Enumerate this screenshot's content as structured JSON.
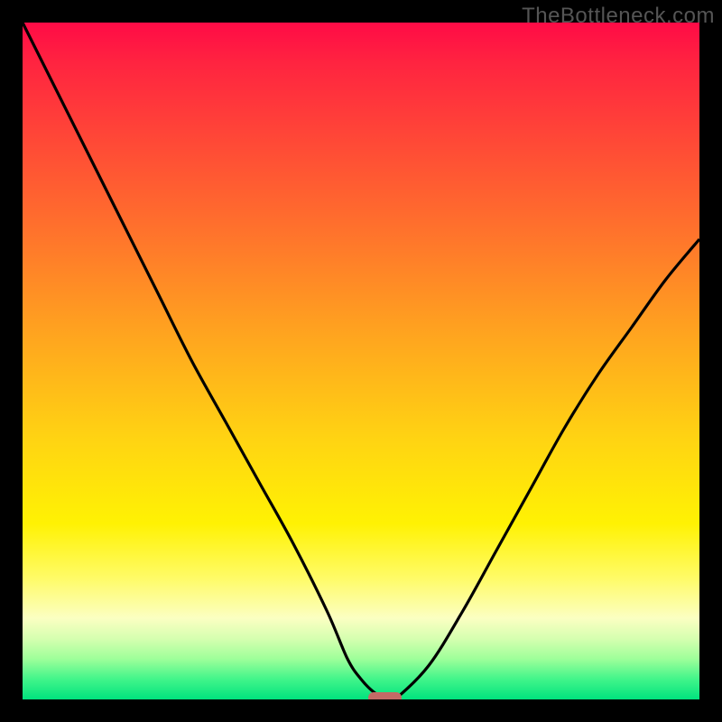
{
  "watermark": "TheBottleneck.com",
  "colors": {
    "curve_stroke": "#000000",
    "marker_fill": "#c46a66",
    "frame_bg": "#000000"
  },
  "chart_data": {
    "type": "line",
    "title": "",
    "xlabel": "",
    "ylabel": "",
    "xlim": [
      0,
      100
    ],
    "ylim": [
      0,
      100
    ],
    "grid": false,
    "legend": false,
    "series": [
      {
        "name": "bottleneck-curve",
        "x": [
          0,
          5,
          10,
          15,
          20,
          25,
          30,
          35,
          40,
          45,
          48,
          50,
          52,
          54,
          55,
          60,
          65,
          70,
          75,
          80,
          85,
          90,
          95,
          100
        ],
        "y": [
          100,
          90,
          80,
          70,
          60,
          50,
          41,
          32,
          23,
          13,
          6,
          3,
          1,
          0,
          0,
          5,
          13,
          22,
          31,
          40,
          48,
          55,
          62,
          68
        ]
      }
    ],
    "marker": {
      "x_start": 51,
      "x_end": 56,
      "y": 0
    },
    "gradient_stops": [
      {
        "pos": 0,
        "color": "#ff0b46"
      },
      {
        "pos": 18,
        "color": "#ff4a36"
      },
      {
        "pos": 46,
        "color": "#ffa41f"
      },
      {
        "pos": 74,
        "color": "#fff203"
      },
      {
        "pos": 88,
        "color": "#fbffc2"
      },
      {
        "pos": 100,
        "color": "#00e27e"
      }
    ]
  }
}
